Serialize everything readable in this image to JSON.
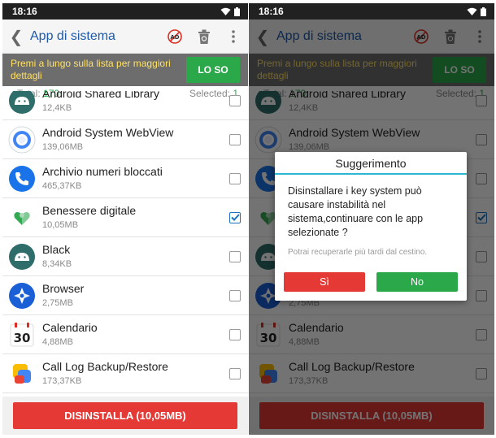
{
  "status": {
    "time": "18:16"
  },
  "header": {
    "title": "App di sistema",
    "back_icon": "back-arrow",
    "actions": [
      "ad-blocked-icon",
      "recycle-bin-icon",
      "more-vert-icon"
    ]
  },
  "hint": {
    "text": "Premi a lungo sulla lista per maggiori dettagli",
    "button": "LO SO"
  },
  "counts": {
    "total_label": "Total: ",
    "total": "170",
    "selected_label": "Selected: ",
    "selected": "1"
  },
  "items": [
    {
      "name": "Android Shared Library",
      "size": "12,4KB",
      "icon": "android-icon",
      "checked": false
    },
    {
      "name": "Android System WebView",
      "size": "139,06MB",
      "icon": "webview-icon",
      "checked": false
    },
    {
      "name": "Archivio numeri bloccati",
      "size": "465,37KB",
      "icon": "phone-icon",
      "checked": false
    },
    {
      "name": "Benessere digitale",
      "size": "10,05MB",
      "icon": "digital-wellbeing-icon",
      "checked": true
    },
    {
      "name": "Black",
      "size": "8,34KB",
      "icon": "android-icon",
      "checked": false
    },
    {
      "name": "Browser",
      "size": "2,75MB",
      "icon": "browser-icon",
      "checked": false
    },
    {
      "name": "Calendario",
      "size": "4,88MB",
      "icon": "calendar-icon",
      "checked": false,
      "icon_text": "30"
    },
    {
      "name": "Call Log Backup/Restore",
      "size": "173,37KB",
      "icon": "call-log-icon",
      "checked": false
    }
  ],
  "uninstall": {
    "label": "DISINSTALLA (10,05MB)"
  },
  "dialog": {
    "title": "Suggerimento",
    "message": "Disinstallare i key system può causare instabilità nel sistema,continuare con le app selezionate ?",
    "note": "Potrai recuperarle più tardi dal cestino.",
    "yes": "Sì",
    "no": "No"
  },
  "colors": {
    "accent_blue": "#1e5aa8",
    "danger_red": "#e53935",
    "ok_green": "#2aa84a",
    "hint_yellow": "#ffe066",
    "dialog_line": "#2bb6d3"
  }
}
